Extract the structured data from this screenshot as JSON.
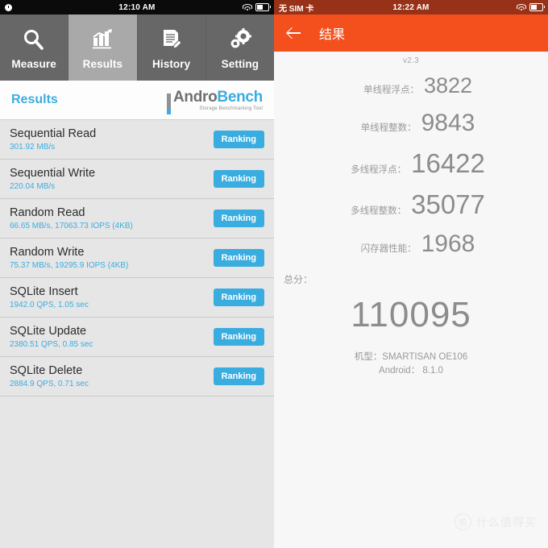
{
  "left_panel": {
    "statusbar": {
      "time": "12:10 AM",
      "clock_icon": "clock-icon",
      "wifi_icon": "wifi-icon",
      "battery_icon": "battery-icon"
    },
    "tabs": [
      {
        "label": "Measure",
        "icon": "magnifier-icon",
        "active": false
      },
      {
        "label": "Results",
        "icon": "bar-chart-icon",
        "active": true
      },
      {
        "label": "History",
        "icon": "document-pen-icon",
        "active": false
      },
      {
        "label": "Setting",
        "icon": "gears-icon",
        "active": false
      }
    ],
    "section_title": "Results",
    "logo": {
      "part1": "Andro",
      "part2": "Bench",
      "tagline": "Storage Benchmarking Tool"
    },
    "ranking_label": "Ranking",
    "rows": [
      {
        "title": "Sequential Read",
        "value": "301.92 MB/s"
      },
      {
        "title": "Sequential Write",
        "value": "220.04 MB/s"
      },
      {
        "title": "Random Read",
        "value": "66.65 MB/s, 17063.73 IOPS (4KB)"
      },
      {
        "title": "Random Write",
        "value": "75.37 MB/s, 19295.9 IOPS (4KB)"
      },
      {
        "title": "SQLite Insert",
        "value": "1942.0 QPS, 1.05 sec"
      },
      {
        "title": "SQLite Update",
        "value": "2380.51 QPS, 0.85 sec"
      },
      {
        "title": "SQLite Delete",
        "value": "2884.9 QPS, 0.71 sec"
      }
    ]
  },
  "right_panel": {
    "statusbar": {
      "sim": "无 SIM 卡",
      "time": "12:22 AM",
      "wifi_icon": "wifi-icon",
      "battery_icon": "battery-icon"
    },
    "appbar": {
      "title": "结果",
      "back_icon": "back-arrow-icon"
    },
    "version": "v2.3",
    "scores": [
      {
        "label": "单线程浮点：",
        "value": "3822"
      },
      {
        "label": "单线程整数：",
        "value": "9843"
      },
      {
        "label": "多线程浮点：",
        "value": "16422"
      },
      {
        "label": "多线程整数：",
        "value": "35077"
      },
      {
        "label": "闪存器性能：",
        "value": "1968"
      }
    ],
    "total_label": "总分：",
    "total_value": "110095",
    "device_model": "机型：SMARTISAN OE106",
    "device_android": "Android： 8.1.0",
    "watermark": {
      "badge": "值",
      "text": "什么值得买"
    }
  },
  "colors": {
    "accent_blue": "#3aade0",
    "accent_orange": "#f4501e",
    "status_orange_dark": "#973218",
    "tab_gray": "#676767"
  }
}
